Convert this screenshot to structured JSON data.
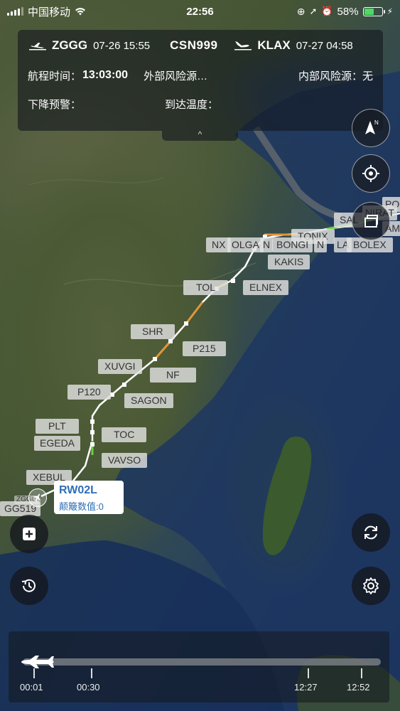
{
  "status_bar": {
    "carrier": "中国移动",
    "time": "22:56",
    "battery": "58%"
  },
  "flight_info": {
    "origin_code": "ZGGG",
    "origin_time": "07-26 15:55",
    "flight_number": "CSN999",
    "dest_code": "KLAX",
    "dest_time": "07-27 04:58",
    "duration_label": "航程时间：",
    "duration_value": "13:03:00",
    "external_risk_label": "外部风险源…",
    "internal_risk_label": "内部风险源：",
    "internal_risk_value": "无",
    "descent_warning_label": "下降预警：",
    "arrival_temp_label": "到达温度：",
    "expand_glyph": "^"
  },
  "waypoints": [
    "PO",
    "NIRAT",
    "AM",
    "SAL",
    "TONIX",
    "NX",
    "OLGA",
    "N",
    "BONGI",
    "N",
    "LA",
    "BOLEX",
    "KAKIS",
    "TOL",
    "ELNEX",
    "SHR",
    "P215",
    "XUVGI",
    "NF",
    "P120",
    "SAGON",
    "PLT",
    "EGEDA",
    "TOC",
    "VAVSO",
    "XEBUL",
    "GG519",
    "ZGGG"
  ],
  "runway_tooltip": {
    "runway": "RW02L",
    "bump_label": "颠簸数值:0"
  },
  "timeline": {
    "progress": 0,
    "labels": [
      "00:01",
      "00:30",
      "12:27",
      "12:52"
    ]
  },
  "icons": {
    "compass": "compass-north-icon",
    "locate": "crosshair-icon",
    "layers": "layers-icon",
    "add": "plus-square-icon",
    "refresh": "refresh-icon",
    "history": "history-clock-icon",
    "settings": "gear-icon"
  },
  "colors": {
    "route_green": "#6ad046",
    "route_orange": "#e3953a",
    "route_white": "#ffffff",
    "tooltip_blue": "#2f6eb6",
    "battery_green": "#4cd964"
  }
}
